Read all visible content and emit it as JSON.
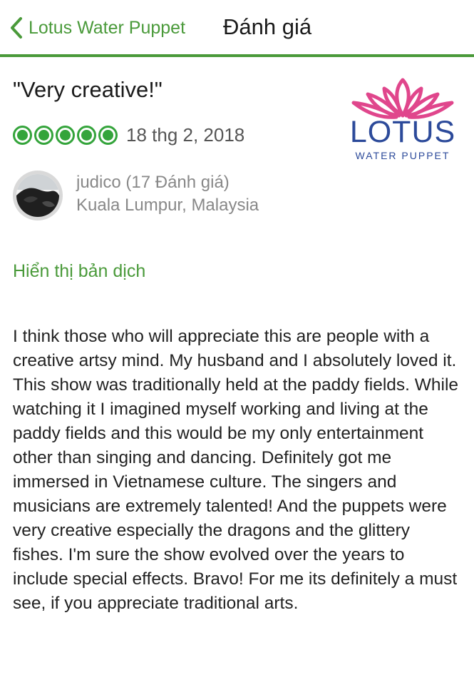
{
  "header": {
    "back_label": "Lotus Water Puppet",
    "title": "Đánh giá",
    "accent_color": "#4a9a3a"
  },
  "review": {
    "title": "\"Very creative!\"",
    "rating": 5,
    "rating_max": 5,
    "rating_color": "#34a43b",
    "date": "18 thg 2, 2018",
    "translate_link": "Hiển thị bản dịch",
    "body": "I think those who will appreciate this are people with a creative artsy mind. My husband and I absolutely loved it. This show was traditionally held at the paddy fields. While watching it I imagined myself working and living at the paddy fields and this would be my only entertainment other than singing and dancing. Definitely got me immersed in Vietnamese culture. The singers and musicians are extremely talented! And the puppets were very creative especially the dragons and the glittery fishes. I'm sure the show evolved over the years to include special effects. Bravo! For me its definitely a must see, if you appreciate traditional arts."
  },
  "reviewer": {
    "name": "judico (17 Đánh giá)",
    "location": "Kuala Lumpur, Malaysia",
    "avatar_icon": "reviewer-photo"
  },
  "logo": {
    "text": "LOTUS",
    "subtext": "WATER PUPPET",
    "icon": "lotus-flower-icon",
    "flower_color": "#e0468c",
    "text_color": "#2c4a9a"
  }
}
